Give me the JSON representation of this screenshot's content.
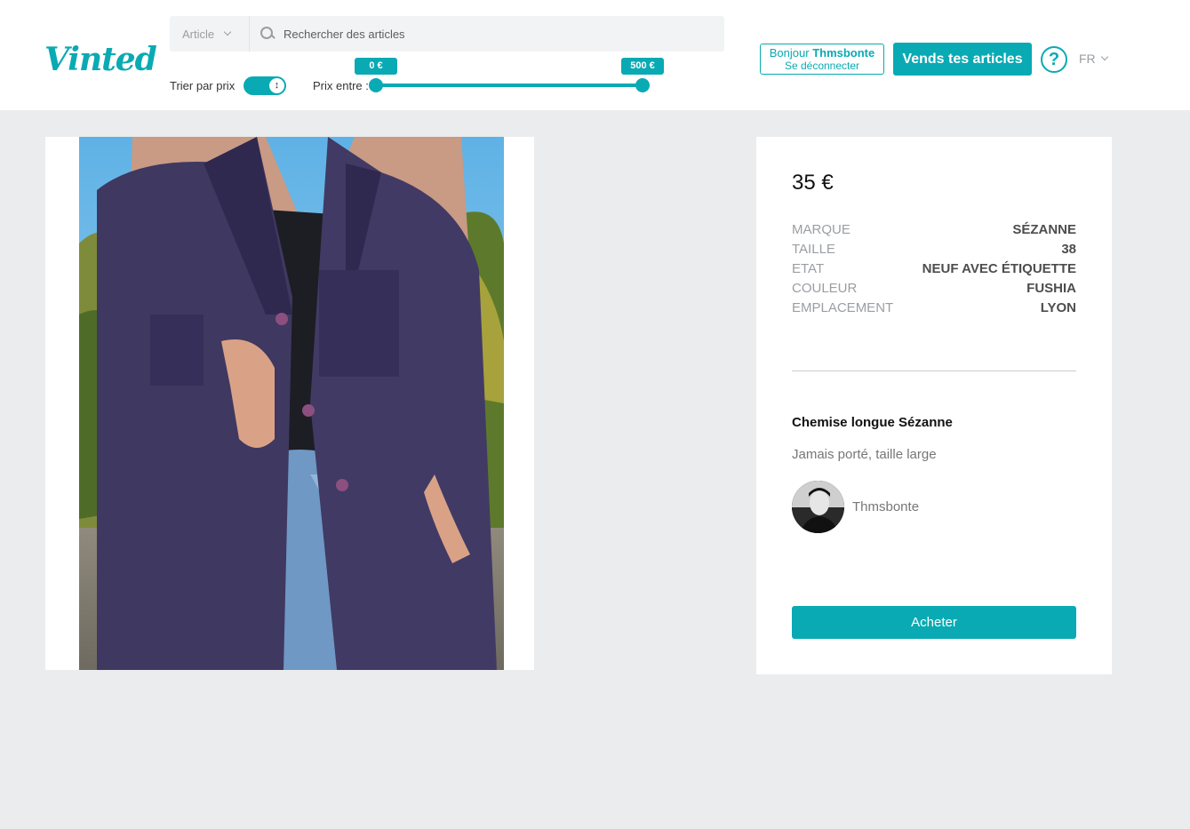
{
  "header": {
    "logo_text": "Vinted",
    "search": {
      "category_value": "Article",
      "placeholder": "Rechercher des articles"
    },
    "sort": {
      "label": "Trier par prix",
      "toggle_on": true
    },
    "price_filter": {
      "label": "Prix entre :",
      "min_label": "0 €",
      "max_label": "500 €",
      "min_value": 0,
      "max_value": 500
    },
    "user": {
      "greeting": "Bonjour",
      "username": "Thmsbonte",
      "logout_label": "Se déconnecter"
    },
    "sell_button_label": "Vends tes articles",
    "help_label": "?",
    "language": "FR"
  },
  "item": {
    "price": "35 €",
    "attributes": [
      {
        "key": "MARQUE",
        "value": "SÉZANNE"
      },
      {
        "key": "TAILLE",
        "value": "38"
      },
      {
        "key": "ETAT",
        "value": "NEUF AVEC ÉTIQUETTE"
      },
      {
        "key": "COULEUR",
        "value": "FUSHIA"
      },
      {
        "key": "EMPLACEMENT",
        "value": "LYON"
      }
    ],
    "title": "Chemise longue Sézanne",
    "description": "Jamais porté, taille large",
    "seller_name": "Thmsbonte",
    "buy_button_label": "Acheter"
  },
  "colors": {
    "accent": "#09aab3",
    "page_background": "#ebeced"
  }
}
